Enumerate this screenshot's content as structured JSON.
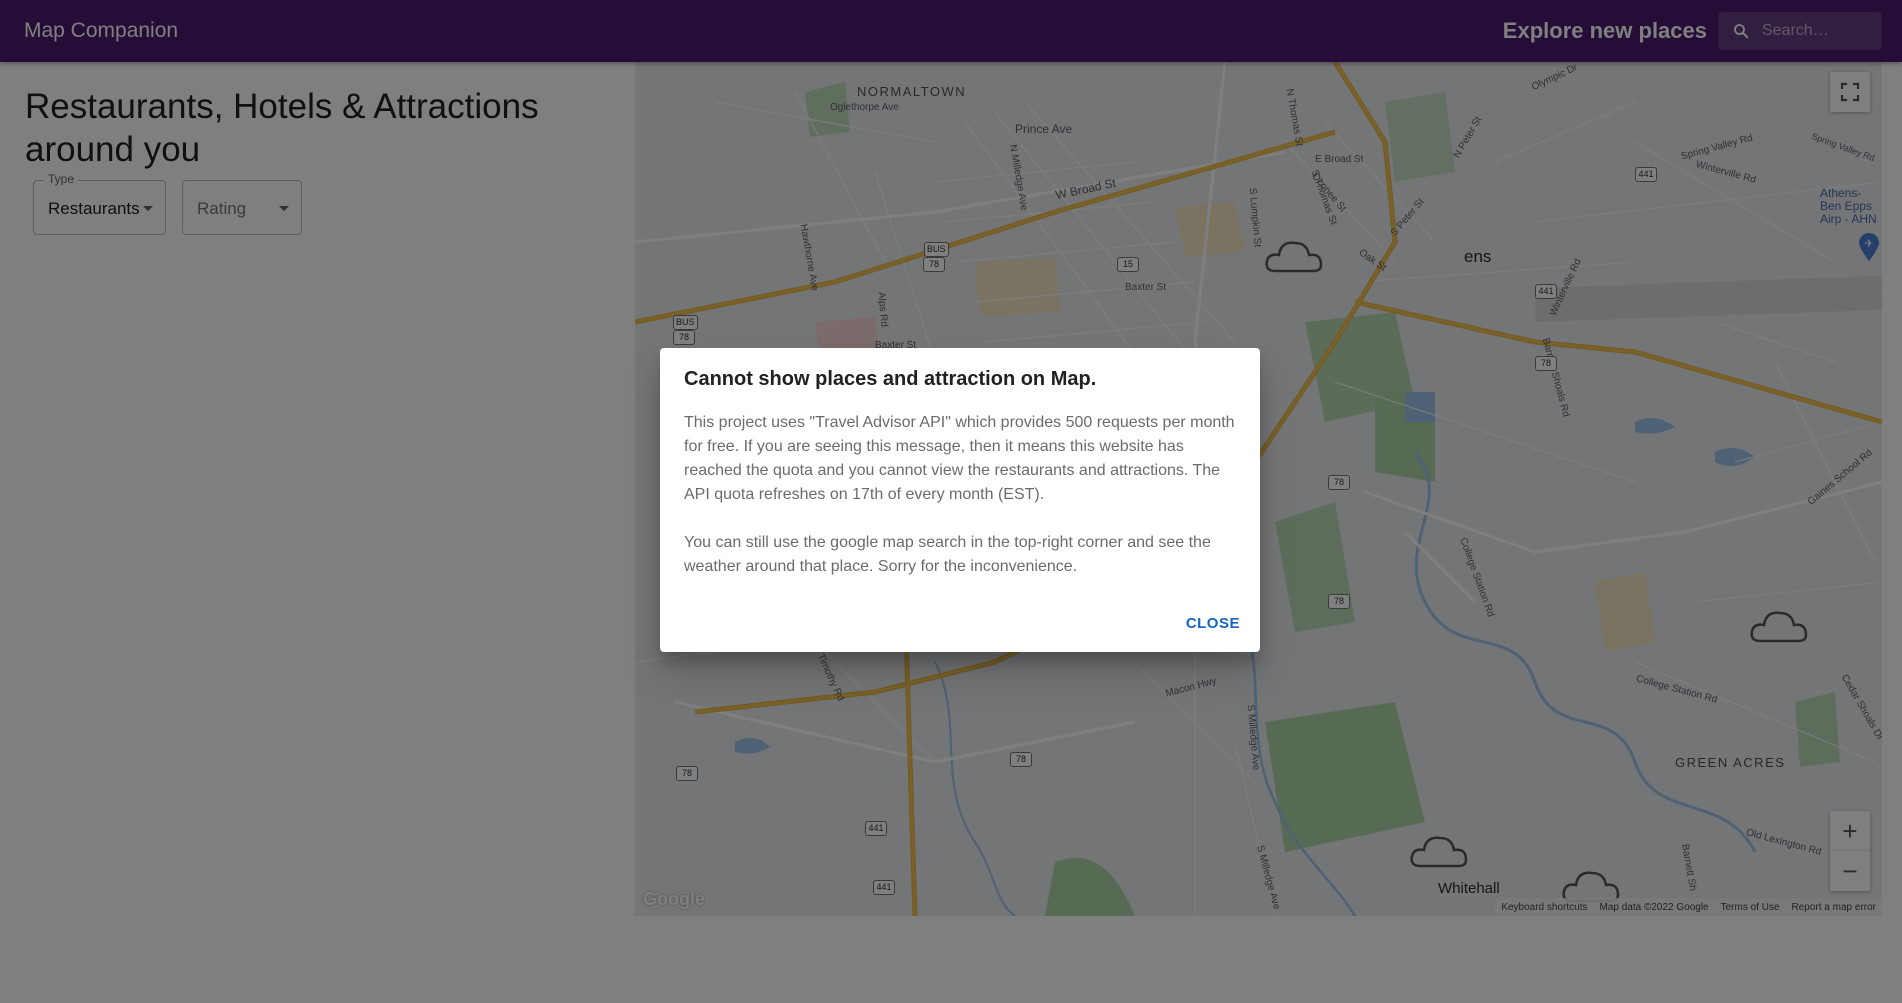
{
  "app": {
    "title": "Map Companion",
    "explore_label": "Explore new places"
  },
  "search": {
    "placeholder": "Search…",
    "icon": "search-icon"
  },
  "left": {
    "heading": "Restaurants, Hotels & Attractions around you",
    "type_select": {
      "label": "Type",
      "value": "Restaurants"
    },
    "rating_select": {
      "label": "Rating",
      "value": ""
    }
  },
  "map": {
    "labels": {
      "normaltown": "NORMALTOWN",
      "oglethorpe": "Oglethorpe Ave",
      "prince": "Prince Ave",
      "wbroad": "W Broad St",
      "baxter": "Baxter St",
      "baxter2": "Baxter St",
      "hawthorne": "Hawthorne Ave",
      "alps": "Alps Rd",
      "nmilledge": "N Milledge Ave",
      "slumpkin": "S Lumpkin St",
      "nthomas": "N Thomas St",
      "sthomas": "S Thomas St",
      "oconee": "Oconee St",
      "oak": "Oak St",
      "ebroad": "E Broad St",
      "speter": "S Peter St",
      "npeter": "N Peter St",
      "athens": "ens",
      "olympic": "Olympic Dr",
      "springvalley": "Spring Valley Rd",
      "springvalley2": "Spring Valley Rd",
      "winterville": "Winterville Rd",
      "winterville2": "Winterville Rd",
      "airport": "Athens-Ben Epps Airp - AHN",
      "barnett": "Barnett Shoals Rd",
      "collegestation": "College Station Rd",
      "collegestation2": "College Station Rd",
      "gaines": "Gaines School Rd",
      "cedarshoals": "Cedar Shoals Dr",
      "greenacres": "GREEN ACRES",
      "oldlexington": "Old Lexington Rd",
      "whitehall": "Whitehall",
      "macon": "Macon Hwy",
      "smilledge": "S Milledge Ave",
      "smilledge2": "S Milledge Ave",
      "timothy": "Timothy Rd",
      "barnettsh": "Barnett Sh"
    },
    "shields": [
      "78",
      "78",
      "78",
      "78",
      "78",
      "78",
      "78",
      "78",
      "441",
      "441",
      "441",
      "441",
      "15",
      "BUS",
      "BUS"
    ],
    "google_logo": "Google",
    "attribution": {
      "keyboard": "Keyboard shortcuts",
      "mapdata": "Map data ©2022 Google",
      "terms": "Terms of Use",
      "report": "Report a map error"
    },
    "controls": {
      "zoom_in": "+",
      "zoom_out": "−"
    }
  },
  "dialog": {
    "title": "Cannot show places and attraction on Map.",
    "paragraph1": "This project uses \"Travel Advisor API\" which provides 500 requests per month for free. If you are seeing this message, then it means this website has reached the quota and you cannot view the restaurants and attractions. The API quota refreshes on 17th of every month (EST).",
    "paragraph2": "You can still use the google map search in the top-right corner and see the weather around that place. Sorry for the inconvenience.",
    "close_label": "CLOSE"
  },
  "colors": {
    "appbar": "#4a1a6e",
    "highway": "#f3c254",
    "water": "#9ec3ea",
    "park": "#aed6a8",
    "link": "#1565c0"
  }
}
